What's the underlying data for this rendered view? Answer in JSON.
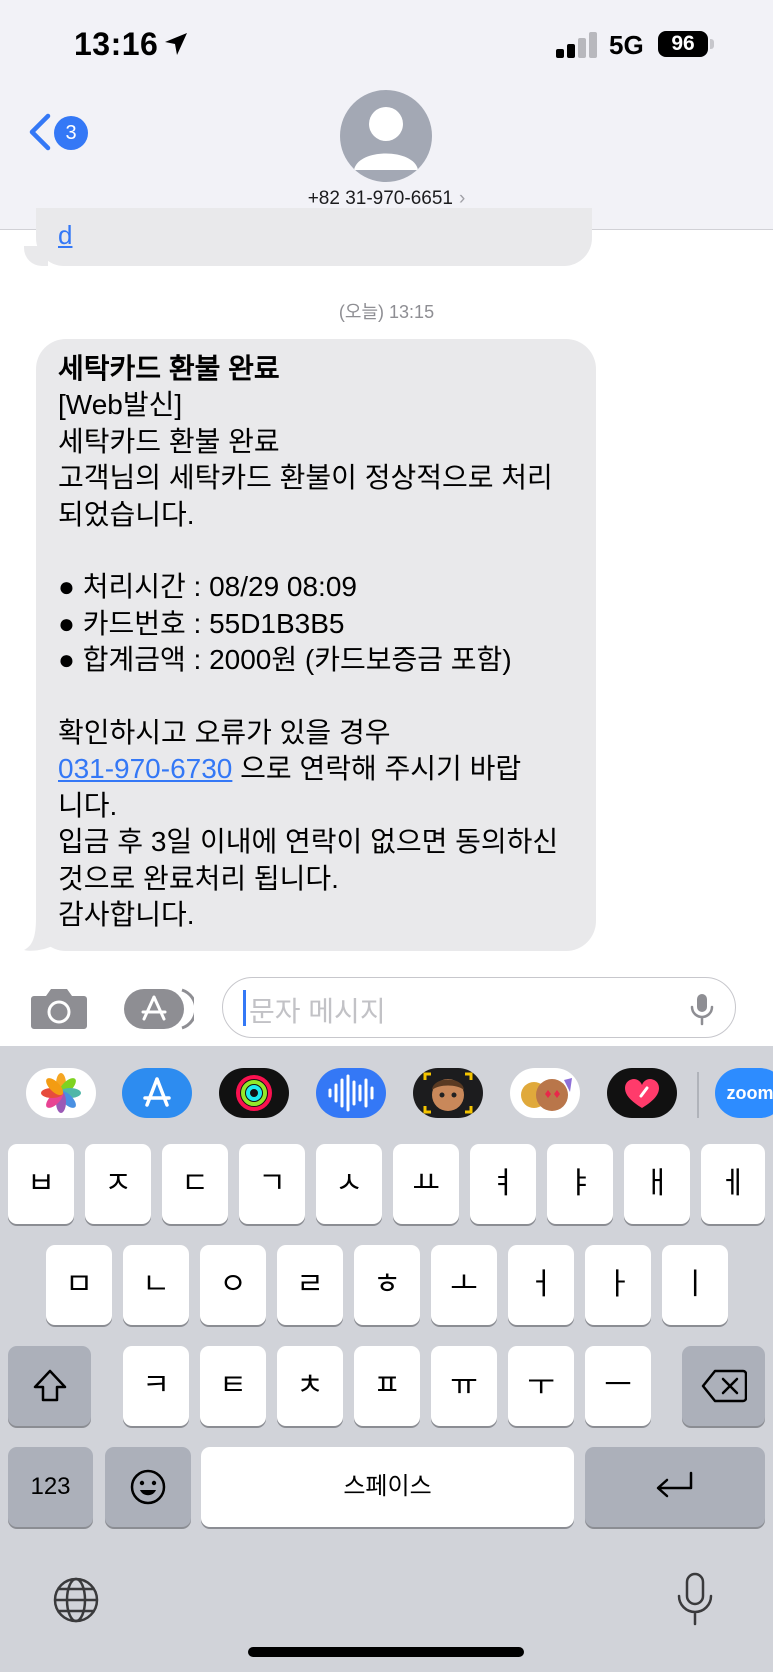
{
  "status_bar": {
    "time": "13:16",
    "network": "5G",
    "battery": "96"
  },
  "header": {
    "back_badge": "3",
    "contact": "+82 31-970-6651",
    "chevron": "›"
  },
  "conversation": {
    "previous_link_fragment": "d",
    "timestamp": "(오늘) 13:15",
    "message": {
      "title": "세탁카드 환불 완료",
      "lines": [
        "[Web발신]",
        "세탁카드 환불 완료",
        "고객님의 세탁카드 환불이 정상적으로 처리",
        "되었습니다.",
        "",
        "● 처리시간 : 08/29 08:09",
        "● 카드번호 : 55D1B3B5",
        "● 합계금액 : 2000원 (카드보증금 포함)",
        "",
        "확인하시고 오류가 있을 경우"
      ],
      "phone_link": "031-970-6730",
      "after_link": " 으로 연락해 주시기 바랍",
      "tail_lines": [
        "니다.",
        "입금 후 3일 이내에 연락이 없으면 동의하신",
        "것으로 완료처리 됩니다.",
        "감사합니다."
      ]
    }
  },
  "compose": {
    "placeholder": "문자 메시지"
  },
  "app_strip": {
    "icons": [
      "photos-icon",
      "app-store-icon",
      "fitness-rings-icon",
      "audio-message-icon",
      "memoji-icon",
      "animoji-icon",
      "digital-touch-icon",
      "zoom-icon"
    ],
    "zoom_label": "zoom"
  },
  "keyboard": {
    "row1": [
      "ㅂ",
      "ㅈ",
      "ㄷ",
      "ㄱ",
      "ㅅ",
      "ㅛ",
      "ㅕ",
      "ㅑ",
      "ㅐ",
      "ㅔ"
    ],
    "row2": [
      "ㅁ",
      "ㄴ",
      "ㅇ",
      "ㄹ",
      "ㅎ",
      "ㅗ",
      "ㅓ",
      "ㅏ",
      "ㅣ"
    ],
    "row3": [
      "ㅋ",
      "ㅌ",
      "ㅊ",
      "ㅍ",
      "ㅠ",
      "ㅜ",
      "ㅡ"
    ],
    "numbers_key": "123",
    "space_key": "스페이스"
  },
  "colors": {
    "accent": "#3478f6",
    "bubble": "#e9e9eb",
    "keyboard_bg": "#d1d3d9"
  }
}
